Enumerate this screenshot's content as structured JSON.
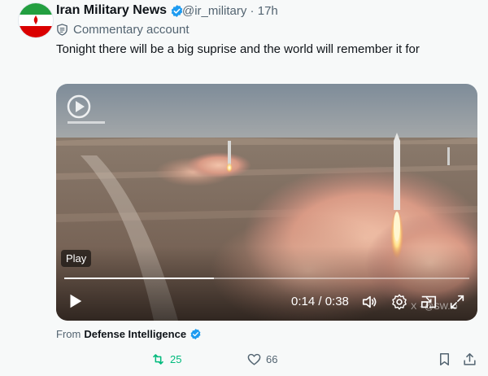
{
  "author": {
    "name": "Iran Military News",
    "handle": "@ir_military · 17h",
    "label": "Commentary account"
  },
  "tweet": {
    "text": "Tonight there will be a big suprise and the world will remember it for"
  },
  "video": {
    "play_badge": "Play",
    "time": "0:14 / 0:38",
    "progress": 0.37,
    "watermark": "X · @SW..o"
  },
  "source": {
    "prefix": "From",
    "name": "Defense Intelligence"
  },
  "actions": {
    "retweets": "25",
    "likes": "66"
  },
  "colors": {
    "verified": "#1d9bf0",
    "retweet": "#00ba7c",
    "muted": "#536471"
  }
}
